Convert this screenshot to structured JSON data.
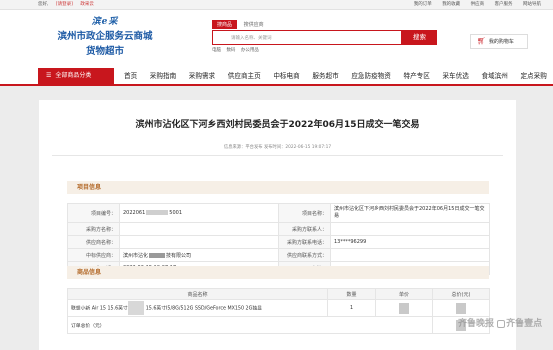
{
  "topbar": {
    "greeting": "您好,",
    "login": "[请登录]",
    "shop_login": "政采云",
    "links": [
      "我的订单",
      "我的收藏",
      "供应商",
      "客户服务",
      "网站导航"
    ]
  },
  "logo": {
    "mark": "滨e采",
    "line1": "滨州市政企服务云商城",
    "line2": "货物超市"
  },
  "search": {
    "tabs": [
      "搜商品",
      "搜供应商"
    ],
    "placeholder": "请输入名称、关键词",
    "button": "搜索",
    "hot": [
      "电脑",
      "数码",
      "办公用品"
    ]
  },
  "cart": {
    "label": "我的购物车"
  },
  "nav": {
    "all_categories": "全部商品分类",
    "items": [
      "首页",
      "采购指南",
      "采购需求",
      "供应商主页",
      "中标电商",
      "服务超市",
      "应急防疫物资",
      "特产专区",
      "采车优选",
      "食域滨州",
      "定点采购"
    ]
  },
  "page": {
    "title": "滨州市沾化区下河乡西刘村民委员会于2022年06月15日成交一笔交易",
    "meta": "信息来源：平台发布  发布时间：2022-06-15 19:07:17"
  },
  "project": {
    "header": "项目信息",
    "rows": [
      {
        "l1": "项目编号：",
        "v1a": "2022061",
        "v1b": "5001",
        "l2": "项目名称：",
        "v2": "滨州市沾化区下河乡西刘村民委员会于2022年06月15日成交一笔交易"
      },
      {
        "l1": "采购方名称：",
        "v1": "",
        "l2": "采购方联系人：",
        "v2": ""
      },
      {
        "l1": "供应商名称：",
        "v1": "",
        "l2": "采购方联系电话：",
        "v2": "13****96299"
      },
      {
        "l1": "中标供应商：",
        "v1a": "滨州市沾化",
        "v1b": "技有限公司",
        "l2": "供应商联系方式：",
        "v2": ""
      },
      {
        "l1": "公告日期：",
        "v1": "2022-06-15 19:07:17",
        "l2": "备注：",
        "v2": ""
      }
    ]
  },
  "goods": {
    "header": "商品信息",
    "columns": [
      "商品名称",
      "数量",
      "单价",
      "总价(元)"
    ],
    "rows": [
      {
        "name_a": "联想小新 Air 15 15.6英寸",
        "name_b": "15.6英寸I5/8G/512G SSD/GeForce MX150 2G独显",
        "qty": "1"
      }
    ],
    "total_label": "订单总价（元）"
  },
  "watermark": {
    "text1": "齐鲁晚报",
    "text2": "齐鲁壹点"
  },
  "colors": {
    "brand_red": "#c8161d",
    "brand_blue": "#1d5aa5",
    "section_bg": "#f6efe6"
  }
}
